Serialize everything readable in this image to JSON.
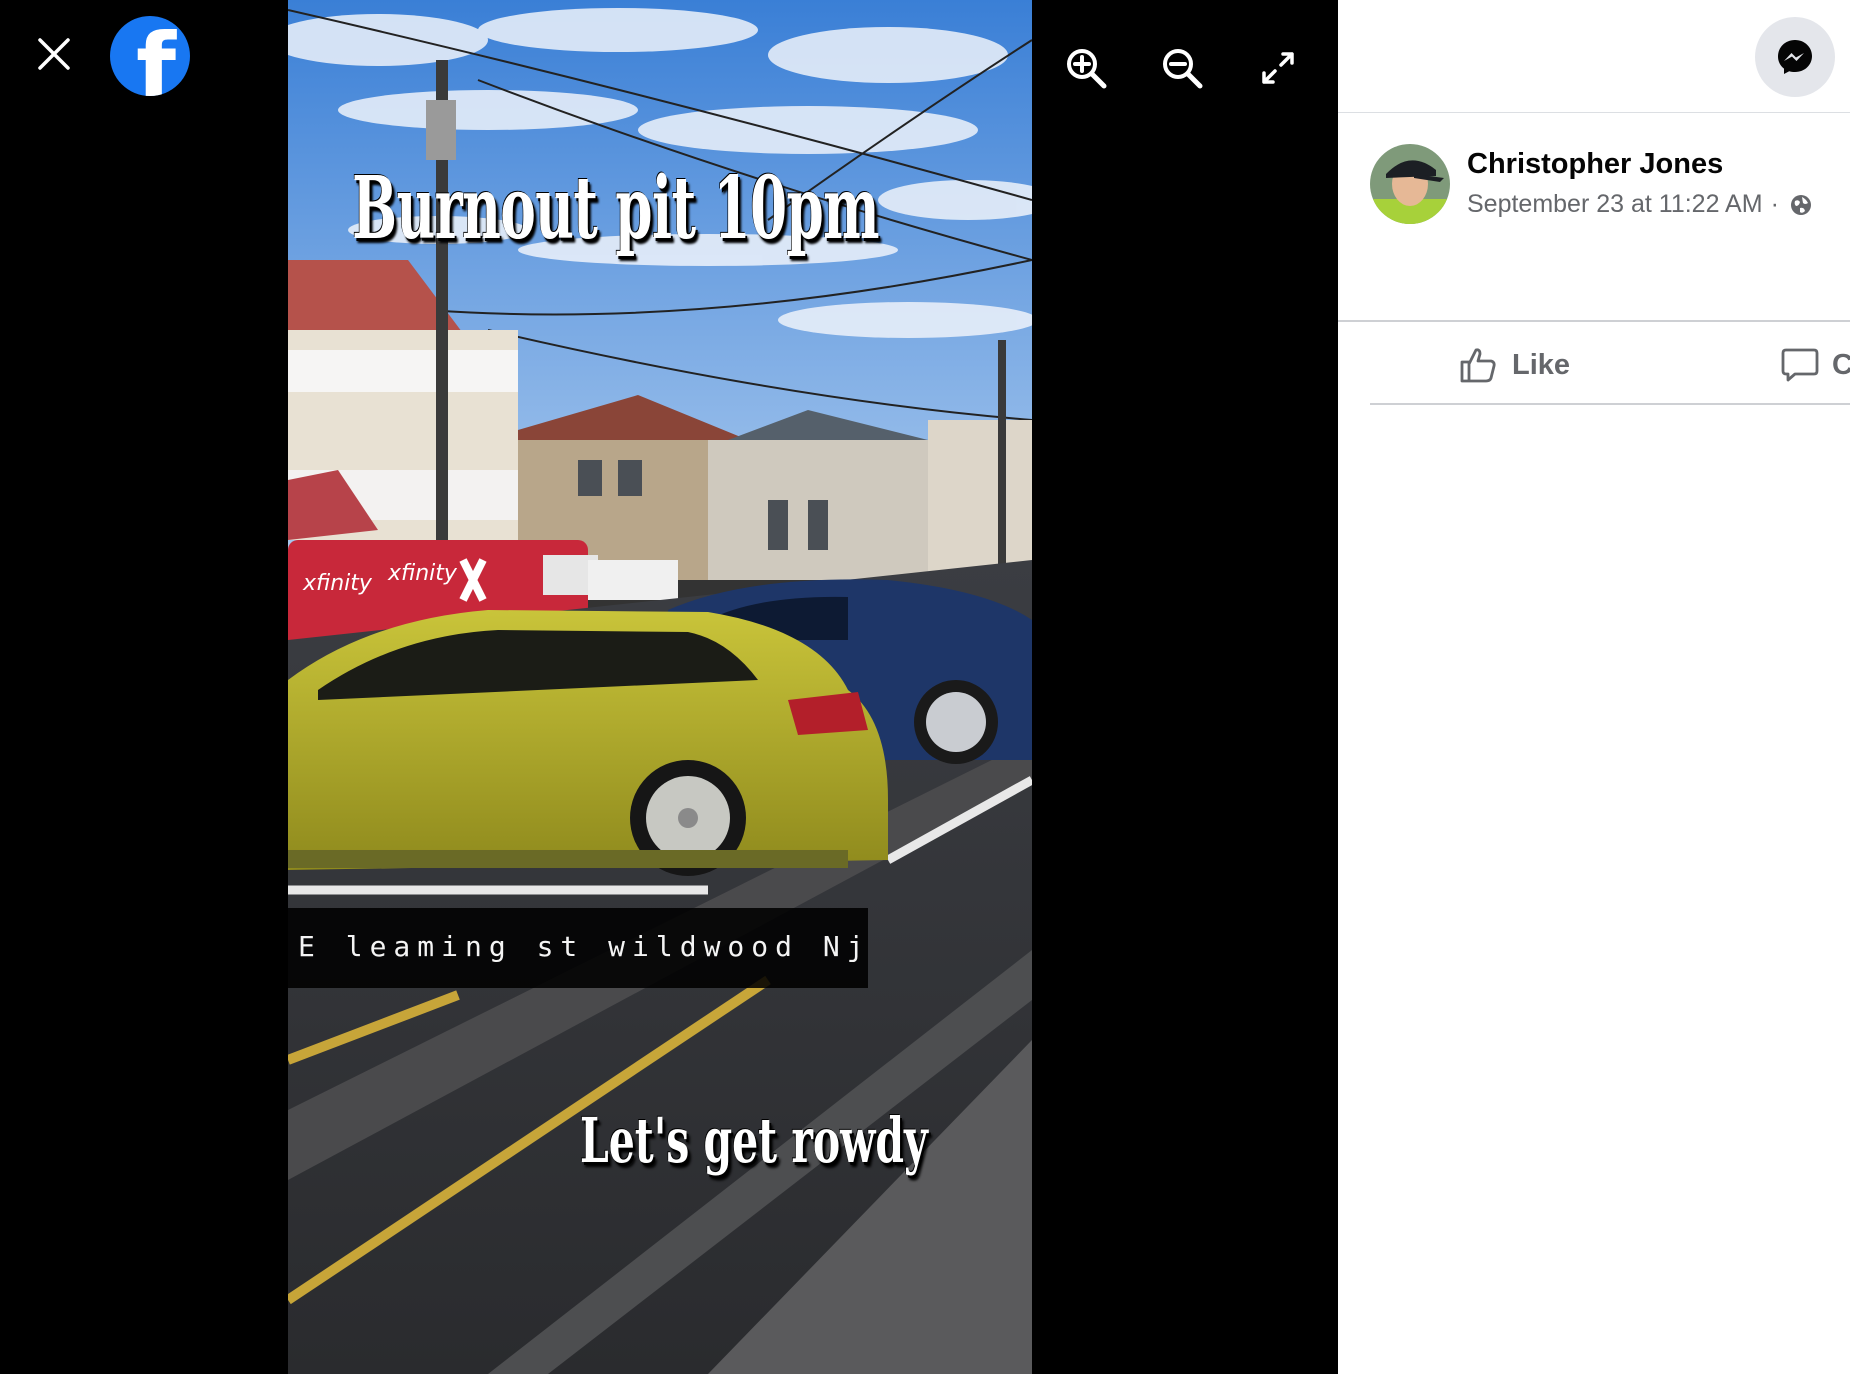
{
  "viewer": {
    "logo_glyph": "f",
    "icons": {
      "close": "close-icon",
      "zoom_in": "zoom-in-icon",
      "zoom_out": "zoom-out-icon",
      "fullscreen": "fullscreen-icon"
    }
  },
  "photo": {
    "caption_top": "Burnout pit 10pm",
    "address": "E leaming st wildwood Nj",
    "caption_bottom": "Let's get rowdy",
    "van_logo_1": "xfinity",
    "van_logo_2": "xfinity"
  },
  "post": {
    "author": "Christopher Jones",
    "date": "September 23 at 11:22 AM",
    "separator": "·",
    "privacy_icon": "globe-icon"
  },
  "actions": {
    "like": "Like",
    "comment": "C"
  },
  "colors": {
    "brand": "#1877f2",
    "viewer_bg": "#000000",
    "secondary_text": "#65676b"
  }
}
